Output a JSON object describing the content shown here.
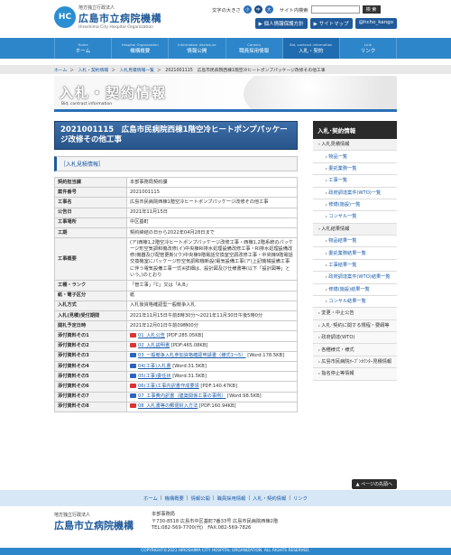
{
  "header": {
    "org_line": "地方独立行政法人",
    "site_name": "広島市立病院機構",
    "site_name_en": "Hiroshima City Hospital Organization",
    "logo_mark": "HC"
  },
  "util": {
    "font_size_label": "文字の大きさ",
    "font_sizes": [
      "小",
      "中",
      "大"
    ],
    "search_label": "サイト内検索",
    "search_button": "検 索",
    "buttons": [
      "▶ 個人情報保護方針",
      "▶ サイトマップ",
      "@hcho_kango"
    ]
  },
  "gnav": [
    {
      "en": "Home",
      "ja": "ホーム"
    },
    {
      "en": "Hospital Organization",
      "ja": "機構概要"
    },
    {
      "en": "Information disclosure",
      "ja": "情報公開"
    },
    {
      "en": "Careers",
      "ja": "職員採用情報"
    },
    {
      "en": "Bid, contract information",
      "ja": "入札・契約"
    },
    {
      "en": "Link",
      "ja": "リンク"
    }
  ],
  "breadcrumb": [
    "ホーム",
    "入札・契約情報",
    "入札見積情報一覧",
    "2021001115　広島市民病院西棟1階空冷ヒートポンプパッケージ改修その他工事"
  ],
  "banner": {
    "title": "入札・契約情報",
    "subtitle": "Bid, contract information"
  },
  "main": {
    "title": "2021001115　広島市民病院西棟1階空冷ヒートポンプパッケージ改修その他工事",
    "section_label": "［入札見積情報］",
    "rows": [
      {
        "k": "契約担当課",
        "v": "本部事務局契約課"
      },
      {
        "k": "案件番号",
        "v": "2021001115"
      },
      {
        "k": "工事名",
        "v": "広島市民病院西棟1階空冷ヒートポンプパッケージ改修その他工事"
      },
      {
        "k": "公告日",
        "v": "2021年11月15日"
      },
      {
        "k": "工事場所",
        "v": "中区基町"
      },
      {
        "k": "工期",
        "v": "契約締結の日から2022年04月28日まで"
      },
      {
        "k": "工事概要",
        "v": "(ア)西棟1,2階空冷ヒートポンプパッケージ改修工事・西棟1,2階系統のパッケージ形空気調和機改修(イ)中央棟RI排水処理設備改修工事・RI排水処理設備改修(機器及び配管更新)(ウ)中央棟9階電話交換室空調改修工事・中央棟9階電話交換機室にパッケージ形空気調和機新設(電気設備工事(ア)上記機械設備工事に伴う電気設備工事一式※詳細は、設計図及び仕様書等(以下「設計図等」という。)のとおり"
      },
      {
        "k": "工種・ランク",
        "v": "「管工事」「C」又は「A,B」"
      },
      {
        "k": "紙・電子区分",
        "v": "紙"
      },
      {
        "k": "入札方式",
        "v": "入札後資格確認型一般競争入札"
      },
      {
        "k": "入札(見積)受付期間",
        "v": "2021年11月15日午前8時30分～2021年11月30日午後5時0分"
      },
      {
        "k": "開札予定日時",
        "v": "2021年12月01日午前09時00分"
      }
    ],
    "attachments": [
      {
        "k": "添付資料その1",
        "type": "pdf",
        "link": "01_入札公告",
        "meta": "[PDF:285.05KB]"
      },
      {
        "k": "添付資料その2",
        "type": "pdf",
        "link": "02_入札説明書",
        "meta": "[PDF:465.08KB]"
      },
      {
        "k": "添付資料その3",
        "type": "word",
        "link": "03_一般競争入札参加資格確認申請書（様式1～5）",
        "meta": "[Word:178.5KB]"
      },
      {
        "k": "添付資料その4",
        "type": "word",
        "link": "04(工事)入札書",
        "meta": "[Word:31.5KB]"
      },
      {
        "k": "添付資料その5",
        "type": "word",
        "link": "05(工事)委任状",
        "meta": "[Word:31.5KB]"
      },
      {
        "k": "添付資料その6",
        "type": "pdf",
        "link": "06(工事)工事内訳書作成要領",
        "meta": "[PDF:140.47KB]"
      },
      {
        "k": "添付資料その7",
        "type": "word",
        "link": "07_工事費内訳書（建築関係工事の事例）",
        "meta": "[Word:98.5KB]"
      },
      {
        "k": "添付資料その8",
        "type": "pdf",
        "link": "08_入札書等の郵便封入方法",
        "meta": "[PDF:160.94KB]"
      }
    ]
  },
  "side": {
    "head": "入札･契約情報",
    "items": [
      {
        "level": "l1 open",
        "label": "入札見積情報"
      },
      {
        "level": "l2",
        "label": "物品一覧"
      },
      {
        "level": "l2",
        "label": "委託業務一覧"
      },
      {
        "level": "l2",
        "label": "工事一覧"
      },
      {
        "level": "l2",
        "label": "政府調達案件(WTO)一覧"
      },
      {
        "level": "l2",
        "label": "修繕(施設)一覧"
      },
      {
        "level": "l2",
        "label": "コンサル一覧"
      },
      {
        "level": "l1 open",
        "label": "入札結果情報"
      },
      {
        "level": "l2",
        "label": "物品結果一覧"
      },
      {
        "level": "l2",
        "label": "委託業務結果一覧"
      },
      {
        "level": "l2",
        "label": "工事結果一覧"
      },
      {
        "level": "l2",
        "label": "政府調達案件(WTO)結果一覧"
      },
      {
        "level": "l2",
        "label": "修繕(施設)結果一覧"
      },
      {
        "level": "l2",
        "label": "コンサル結果一覧"
      },
      {
        "level": "l0",
        "label": "変更・中止公告"
      },
      {
        "level": "l0",
        "label": "入札･契約に関する規程・要綱等"
      },
      {
        "level": "l0",
        "label": "政府調達(WTO)"
      },
      {
        "level": "l0",
        "label": "各種様式・様式"
      },
      {
        "level": "l0",
        "label": "広島市民病院ｵｰﾌﾟﾝｶｳﾝﾀｰ見積情報"
      },
      {
        "level": "l0",
        "label": "指名停止等情報"
      }
    ]
  },
  "pagetop": "▲ ページの先頭へ",
  "footnav": [
    "ホーム",
    "機構概要",
    "情報公開",
    "職員採用情報",
    "入札・契約情報",
    "リンク"
  ],
  "footer": {
    "org_line": "地方独立行政法人",
    "name": "広島市立病院機構",
    "office": "本部事務局",
    "address": "〒730-8518 広島市中区基町7番33号 広島市民病院西棟2階",
    "tel": "TEL:082-569-7700(代)　FAX:082-569-7826",
    "copyright": "COPYRIGHT©2021 HIROSHIMA CITY HOSPITAL ORGANIZATION. ALL RIGHTS RESERVED."
  }
}
